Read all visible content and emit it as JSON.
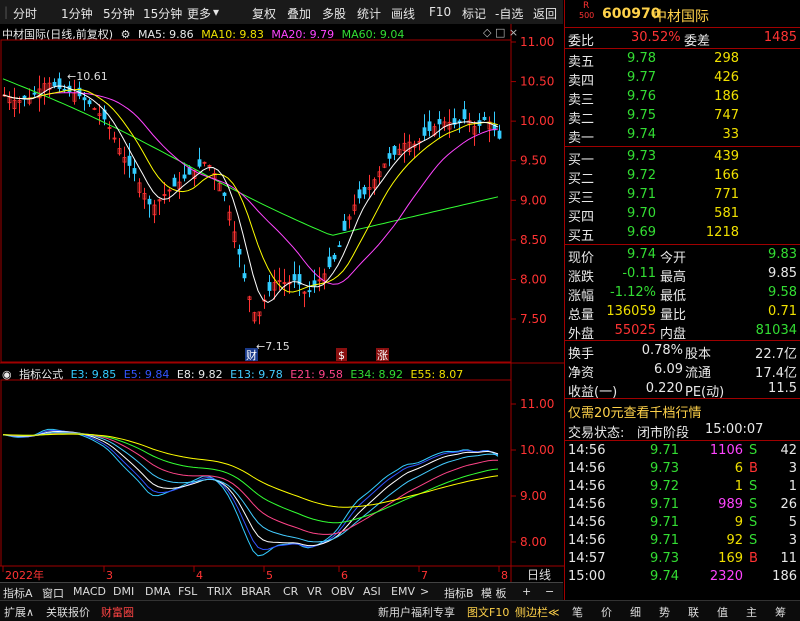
{
  "toolbar": {
    "items": [
      "分时",
      "1分钟",
      "5分钟",
      "15分钟",
      "更多",
      "复权",
      "叠加",
      "多股",
      "统计",
      "画线",
      "F10",
      "标记",
      "-自选",
      "返回"
    ]
  },
  "chart": {
    "title": "中材国际(日线,前复权)",
    "ma5": "MA5: 9.86",
    "ma10": "MA10: 9.83",
    "ma20": "MA20: 9.79",
    "ma60": "MA60: 9.04",
    "y_ticks": [
      "11.00",
      "10.50",
      "10.00",
      "9.50",
      "9.00",
      "8.50",
      "8.00",
      "7.50"
    ],
    "high_label": "10.61",
    "low_label": "7.15",
    "markers": [
      "财",
      "$",
      "涨"
    ]
  },
  "indicator": {
    "title": "指标公式",
    "e3": "E3: 9.85",
    "e5": "E5: 9.84",
    "e8": "E8: 9.82",
    "e13": "E13: 9.78",
    "e21": "E21: 9.58",
    "e34": "E34: 8.92",
    "e55": "E55: 8.07",
    "y_ticks": [
      "11.00",
      "10.00",
      "9.00",
      "8.00"
    ]
  },
  "xaxis": {
    "labels": [
      "2022年",
      "3",
      "4",
      "5",
      "6",
      "7",
      "8"
    ],
    "period": "日线"
  },
  "tabs": [
    "指标A",
    "窗口",
    "MACD",
    "DMI",
    "DMA",
    "FSL",
    "TRIX",
    "BRAR",
    "CR",
    "VR",
    "OBV",
    "ASI",
    "EMV",
    ">",
    "指标B",
    "模 板",
    "+",
    "−"
  ],
  "statusbar": {
    "left": [
      "扩展∧",
      "关联报价",
      "财富圈"
    ],
    "promo": "新用户福利专享",
    "right": [
      "图文F10",
      "侧边栏≪"
    ],
    "keys": [
      "笔",
      "价",
      "细",
      "势",
      "联",
      "值",
      "主",
      "筹"
    ]
  },
  "quote": {
    "code": "600970",
    "name": "中材国际",
    "badge_r": "R",
    "badge_num": "500",
    "weibi_label": "委比",
    "weibi": "30.52%",
    "weicha_label": "委差",
    "weicha": "1485",
    "asks": [
      {
        "label": "卖五",
        "price": "9.78",
        "vol": "298"
      },
      {
        "label": "卖四",
        "price": "9.77",
        "vol": "426"
      },
      {
        "label": "卖三",
        "price": "9.76",
        "vol": "186"
      },
      {
        "label": "卖二",
        "price": "9.75",
        "vol": "747"
      },
      {
        "label": "卖一",
        "price": "9.74",
        "vol": "33"
      }
    ],
    "bids": [
      {
        "label": "买一",
        "price": "9.73",
        "vol": "439"
      },
      {
        "label": "买二",
        "price": "9.72",
        "vol": "166"
      },
      {
        "label": "买三",
        "price": "9.71",
        "vol": "771"
      },
      {
        "label": "买四",
        "price": "9.70",
        "vol": "581"
      },
      {
        "label": "买五",
        "price": "9.69",
        "vol": "1218"
      }
    ],
    "stats": [
      {
        "l1": "现价",
        "v1": "9.74",
        "c1": "green",
        "l2": "今开",
        "v2": "9.83",
        "c2": "green"
      },
      {
        "l1": "涨跌",
        "v1": "-0.11",
        "c1": "green",
        "l2": "最高",
        "v2": "9.85",
        "c2": "white"
      },
      {
        "l1": "涨幅",
        "v1": "-1.12%",
        "c1": "green",
        "l2": "最低",
        "v2": "9.58",
        "c2": "green"
      },
      {
        "l1": "总量",
        "v1": "136059",
        "c1": "yellow",
        "l2": "量比",
        "v2": "0.71",
        "c2": "yellow"
      },
      {
        "l1": "外盘",
        "v1": "55025",
        "c1": "red",
        "l2": "内盘",
        "v2": "81034",
        "c2": "green"
      }
    ],
    "stats2": [
      {
        "l1": "换手",
        "v1": "0.78%",
        "l2": "股本",
        "v2": "22.7亿"
      },
      {
        "l1": "净资",
        "v1": "6.09",
        "l2": "流通",
        "v2": "17.4亿"
      },
      {
        "l1": "收益(一)",
        "v1": "0.220",
        "l2": "PE(动)",
        "v2": "11.5"
      }
    ],
    "promo": "仅需20元查看千档行情",
    "trade_status_label": "交易状态:",
    "trade_status": "闭市阶段",
    "trade_time": "15:00:07",
    "ticks": [
      {
        "t": "14:56",
        "p": "9.71",
        "v": "1106",
        "vc": "magenta",
        "s": "S",
        "n": "42"
      },
      {
        "t": "14:56",
        "p": "9.73",
        "v": "6",
        "vc": "yellow",
        "s": "B",
        "n": "3"
      },
      {
        "t": "14:56",
        "p": "9.72",
        "v": "1",
        "vc": "yellow",
        "s": "S",
        "n": "1"
      },
      {
        "t": "14:56",
        "p": "9.71",
        "v": "989",
        "vc": "magenta",
        "s": "S",
        "n": "26"
      },
      {
        "t": "14:56",
        "p": "9.71",
        "v": "9",
        "vc": "yellow",
        "s": "S",
        "n": "5"
      },
      {
        "t": "14:56",
        "p": "9.71",
        "v": "92",
        "vc": "yellow",
        "s": "S",
        "n": "3"
      },
      {
        "t": "14:57",
        "p": "9.73",
        "v": "169",
        "vc": "yellow",
        "s": "B",
        "n": "11"
      },
      {
        "t": "15:00",
        "p": "9.74",
        "v": "2320",
        "vc": "magenta",
        "s": "",
        "n": "186"
      }
    ]
  },
  "colors": {
    "up": "#ff3333",
    "down": "#33dd33",
    "frame": "#a00000",
    "ma5": "#ffffff",
    "ma10": "#ffff00",
    "ma20": "#ff44ff",
    "ma60": "#33ff33"
  }
}
